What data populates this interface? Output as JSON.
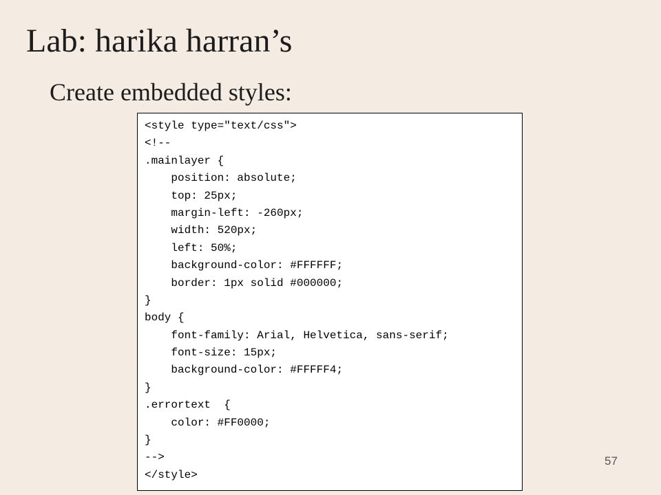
{
  "slide": {
    "title": "Lab: harika harran’s",
    "subtitle": "Create embedded styles:",
    "page_number": "57"
  },
  "code": {
    "lines": [
      "<style type=\"text/css\">",
      "<!--",
      ".mainlayer {",
      "    position: absolute;",
      "    top: 25px;",
      "    margin-left: -260px;",
      "    width: 520px;",
      "    left: 50%;",
      "    background-color: #FFFFFF;",
      "    border: 1px solid #000000;",
      "}",
      "body {",
      "    font-family: Arial, Helvetica, sans-serif;",
      "    font-size: 15px;",
      "    background-color: #FFFFF4;",
      "}",
      ".errortext  {",
      "    color: #FF0000;",
      "}",
      "-->",
      "</style>"
    ]
  }
}
